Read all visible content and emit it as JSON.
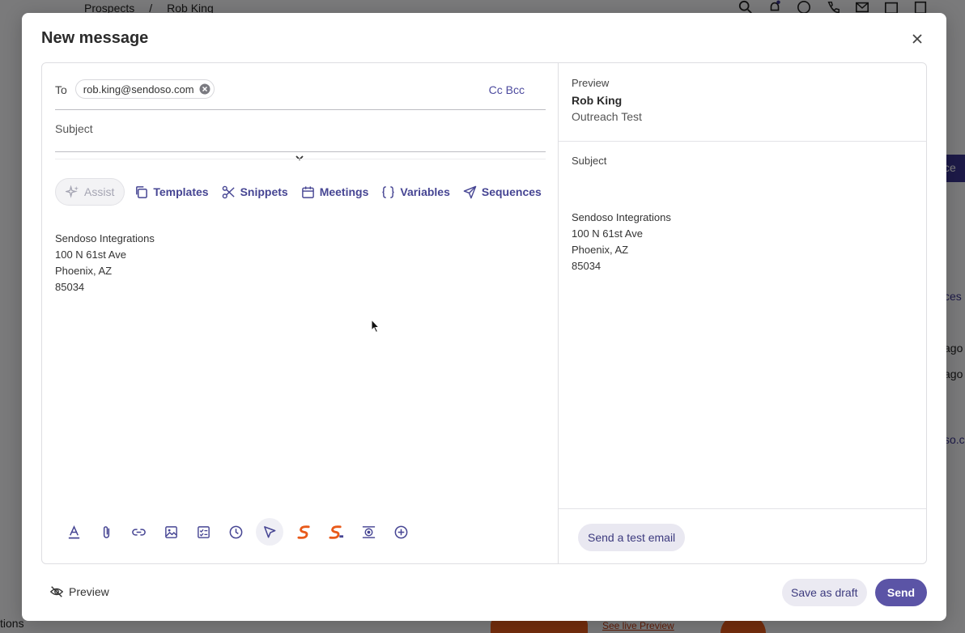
{
  "background": {
    "breadcrumb": [
      "Prospects",
      "/",
      "Rob King"
    ],
    "top_icons": [
      "search-icon",
      "bell-icon",
      "help-icon",
      "phone-icon",
      "mail-icon",
      "calendar-icon",
      "clipboard-icon"
    ],
    "side_button_label": "ce",
    "right_texts": [
      "ces",
      "ago",
      "ago",
      "so.co"
    ],
    "bottom_left_text": "tions",
    "bottom_link": "See live Preview"
  },
  "modal": {
    "title": "New message",
    "to_label": "To",
    "recipient": "rob.king@sendoso.com",
    "cc_bcc": "Cc Bcc",
    "subject_placeholder": "Subject",
    "toolbar": {
      "assist": "Assist",
      "templates": "Templates",
      "snippets": "Snippets",
      "meetings": "Meetings",
      "variables": "Variables",
      "sequences": "Sequences"
    },
    "signature": [
      "Sendoso Integrations",
      "100 N 61st Ave",
      "Phoenix, AZ",
      "85034"
    ],
    "format_icons": [
      "text-format-icon",
      "attachment-icon",
      "link-icon",
      "image-icon",
      "checklist-icon",
      "clock-icon",
      "cursor-icon",
      "sendoso-icon",
      "sendoso-gift-icon",
      "embed-icon",
      "add-icon"
    ]
  },
  "preview": {
    "label": "Preview",
    "name": "Rob King",
    "subtitle": "Outreach Test",
    "subject_label": "Subject",
    "signature": [
      "Sendoso Integrations",
      "100 N 61st Ave",
      "Phoenix, AZ",
      "85034"
    ],
    "test_button": "Send a test email"
  },
  "footer": {
    "preview_toggle": "Preview",
    "save_draft": "Save as draft",
    "send": "Send"
  },
  "colors": {
    "accent": "#5b54a6",
    "accent_text": "#464593",
    "brand_orange": "#e85a1a"
  }
}
